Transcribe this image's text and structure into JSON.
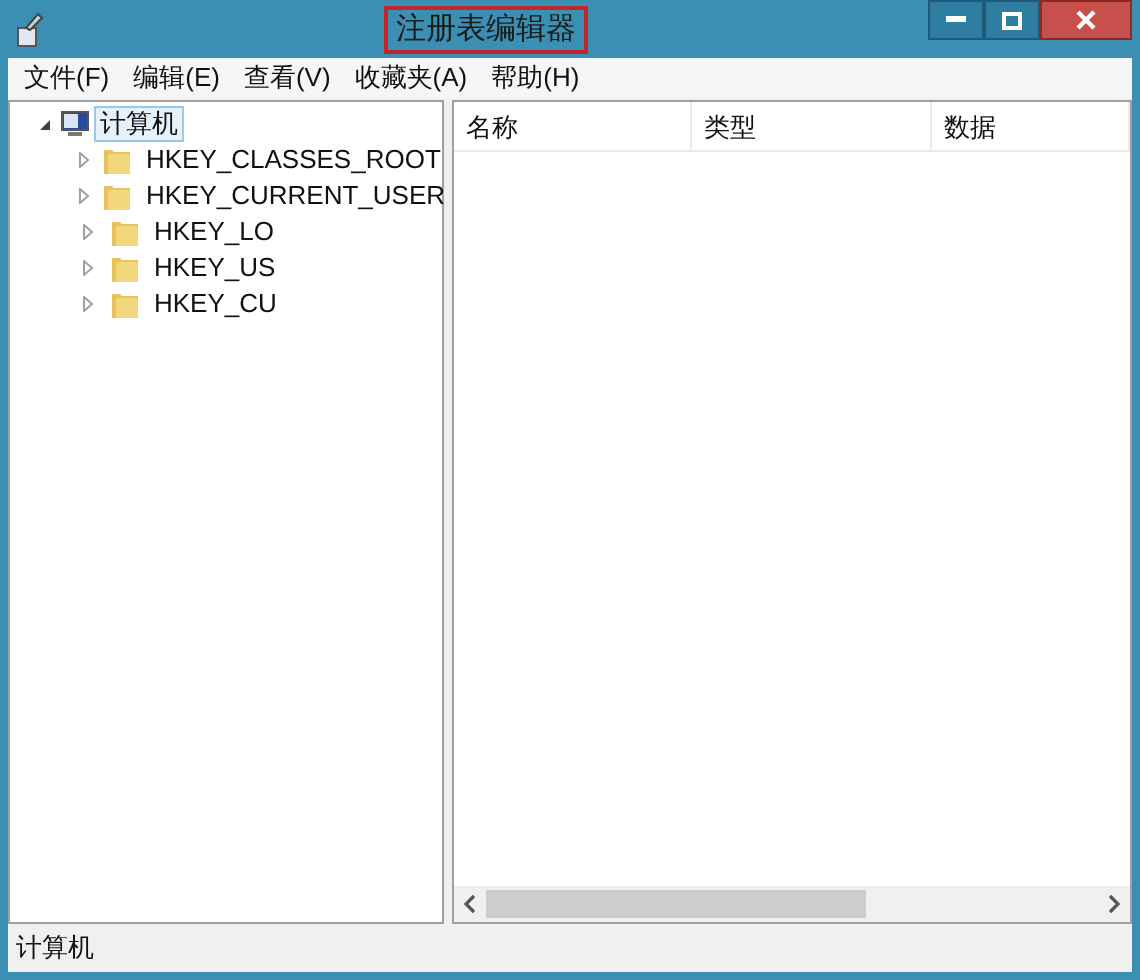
{
  "window": {
    "title": "注册表编辑器"
  },
  "menu": [
    {
      "label": "文件(F)"
    },
    {
      "label": "编辑(E)"
    },
    {
      "label": "查看(V)"
    },
    {
      "label": "收藏夹(A)"
    },
    {
      "label": "帮助(H)"
    }
  ],
  "tree": [
    {
      "label": "计算机",
      "expanded": true,
      "selected": true,
      "kind": "computer",
      "children": [
        {
          "label": "HKEY_CLASSES_ROOT",
          "expanded": false,
          "selected": false,
          "kind": "folder"
        },
        {
          "label": "HKEY_CURRENT_USER",
          "expanded": false,
          "selected": false,
          "kind": "folder"
        },
        {
          "label": "HKEY_LO",
          "expanded": false,
          "selected": false,
          "kind": "folder"
        },
        {
          "label": "HKEY_US",
          "expanded": false,
          "selected": false,
          "kind": "folder"
        },
        {
          "label": "HKEY_CU",
          "expanded": false,
          "selected": false,
          "kind": "folder"
        }
      ]
    }
  ],
  "table": {
    "columns": [
      "名称",
      "类型",
      "数据"
    ]
  },
  "status_bar": "计算机"
}
